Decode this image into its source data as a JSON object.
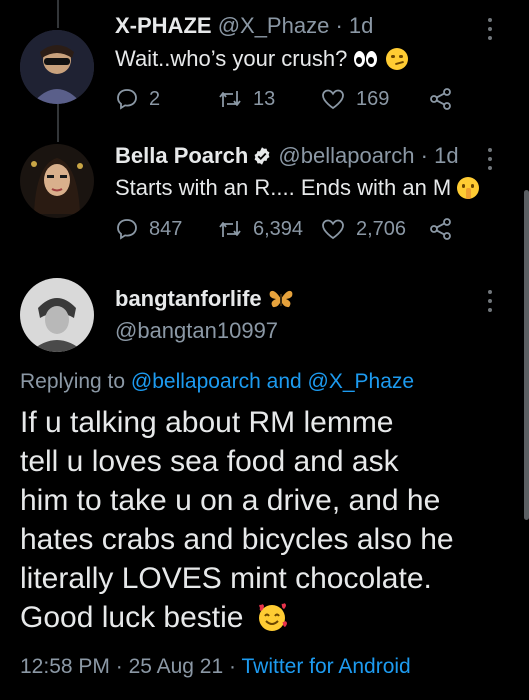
{
  "colors": {
    "background": "#000000",
    "text": "#e7e9ea",
    "muted": "#8b98a5",
    "link": "#1d9bf0",
    "verified": "#1d9bf0"
  },
  "tweet1": {
    "name": "X-PHAZE",
    "handle": "@X_Phaze",
    "separator": "·",
    "time": "1d",
    "text": "Wait..who’s your crush?",
    "emojis": [
      "eyes-emoji",
      "smirk-emoji"
    ],
    "reply_count": "2",
    "retweet_count": "13",
    "like_count": "169"
  },
  "tweet2": {
    "name": "Bella Poarch",
    "handle": "@bellapoarch",
    "separator": "·",
    "time": "1d",
    "text": "Starts with an R.... Ends with an M",
    "emojis": [
      "shushing-face-emoji"
    ],
    "reply_count": "847",
    "retweet_count": "6,394",
    "like_count": "2,706"
  },
  "main_tweet": {
    "name": "bangtanforlife",
    "name_emoji": "butterfly-emoji",
    "handle": "@bangtan10997",
    "replying_prefix": "Replying to",
    "mention1": "@bellapoarch",
    "and_word": "and",
    "mention2": "@X_Phaze",
    "lines": [
      "If u talking about RM lemme",
      "tell u loves sea food and ask",
      "him to take u on a drive, and he",
      "hates crabs and bicycles also he",
      "literally LOVES mint chocolate.",
      "Good luck bestie"
    ],
    "end_emoji": "smiling-face-with-hearts-emoji",
    "time": "12:58 PM",
    "date": "25 Aug 21",
    "dot": "·",
    "source": "Twitter for Android"
  }
}
